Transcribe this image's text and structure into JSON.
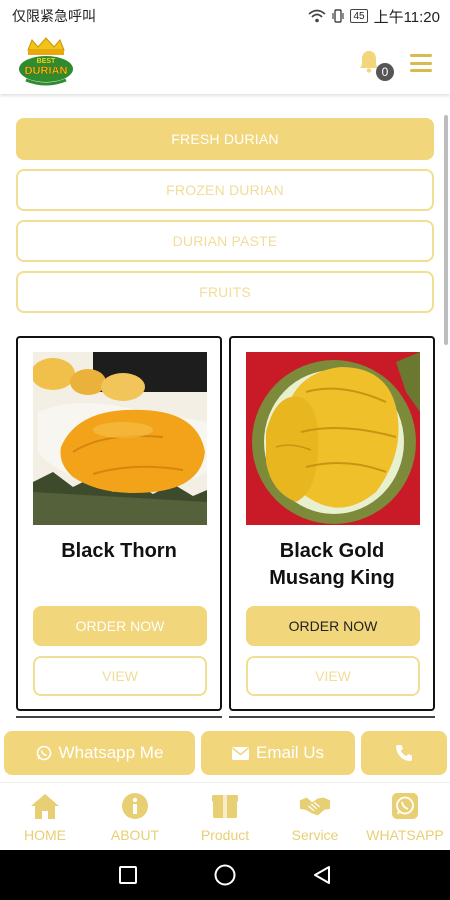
{
  "status_bar": {
    "carrier": "仅限紧急呼叫",
    "battery": "45",
    "time": "上午11:20"
  },
  "header": {
    "logo_name": "best-durian-logo",
    "logo_text_top": "BEST",
    "logo_text_main": "DURIAN",
    "cart_count": "0",
    "accent_color": "#d8bb4c"
  },
  "categories": [
    {
      "label": "FRESH DURIAN",
      "active": true
    },
    {
      "label": "FROZEN DURIAN",
      "active": false
    },
    {
      "label": "DURIAN PASTE",
      "active": false
    },
    {
      "label": "FRUITS",
      "active": false
    }
  ],
  "products": [
    {
      "name": "Black Thorn",
      "order_label": "ORDER NOW",
      "view_label": "VIEW"
    },
    {
      "name": "Black Gold Musang King",
      "order_label": "ORDER NOW",
      "view_label": "VIEW"
    }
  ],
  "contact": {
    "whatsapp_label": "Whatsapp Me",
    "email_label": "Email Us",
    "phone_icon": "phone-icon"
  },
  "bottom_nav": [
    {
      "label": "HOME",
      "icon": "home-icon"
    },
    {
      "label": "ABOUT",
      "icon": "info-icon"
    },
    {
      "label": "Product",
      "icon": "box-icon"
    },
    {
      "label": "Service",
      "icon": "handshake-icon"
    },
    {
      "label": "WHATSAPP",
      "icon": "whatsapp-icon"
    }
  ],
  "colors": {
    "primary": "#f1d67c",
    "outline": "#f0df93",
    "nav_text": "#e8cf74"
  }
}
